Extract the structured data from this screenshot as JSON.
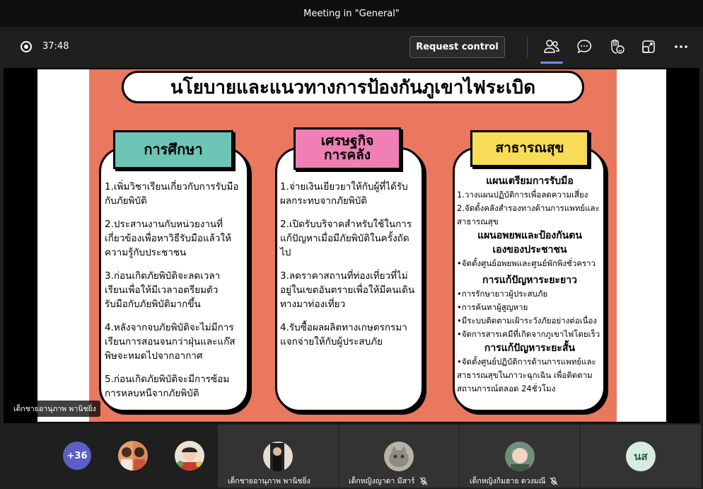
{
  "window": {
    "title": "Meeting in \"General\""
  },
  "toolbar": {
    "timer": "37:48",
    "request_control": "Request control",
    "icons": [
      "people-icon",
      "chat-icon",
      "reactions-icon",
      "share-tray-icon",
      "more-options-icon"
    ]
  },
  "slide": {
    "title": "นโยบายและแนวทางการป้องกันภูเขาไฟระเบิด",
    "col1": {
      "header": "การศึกษา",
      "header_color": "#6cc5b5",
      "items": [
        "1.เพิ่มวิชาเรียนเกี่ยวกับการรับมือกับภัยพิบัติ",
        "2.ประสานงานกับหน่วยงานที่เกี่ยวข้องเพื่อหาวิธีรับมือแล้วให้ความรู้กับประชาชน",
        "3.ก่อนเกิดภัยพิบัติจะลดเวลาเรียนเพื่อให้มีเวลาอตรียมตัวรับมือกับภัยพิบัติมากขึ้น",
        "4.หลังจากจบภัยพิบัติจะไม่มีการเรียนการสอนจนกว่าฝุ่นและแก๊สพิษจะหมดไปจากอากาศ",
        "5.ก่อนเกิดภัยพิบัติจะมีการซ้อมการหลบหนีจากภัยพิบัติ"
      ]
    },
    "col2": {
      "header_line1": "เศรษฐกิจ",
      "header_line2": "การคลัง",
      "header_color": "#ef7fb4",
      "items": [
        "1.จ่ายเงินเยียวยาให้กับผู้ที่ได้รับผลกระทบจากภัยพิบัติ",
        "2.เปิดรับบริจาคสำหรับใช้ในการแก้ปัญหาเมื่อมีภัยพิบัติในครั้งถัดไป",
        "3.ลดราคาสถานที่ท่องเที่ยวที่ไม่อยู่ในเขตอันตรายเพื่อให้มีคนเดินทางมาท่องเที่ยว",
        "4.รับซื้อผลผลิตทางเกษตรกรมาแจกจ่ายให้กับผู้ประสบภัย"
      ]
    },
    "col3": {
      "header": "สาธารณสุข",
      "header_color": "#f7dd57",
      "sec1_title": "แผนเตรียมการรับมือ",
      "sec1_items": [
        "1.วางแผนปฏิบัติการเพื่อลดความเสี่ยง",
        "2.จัดตั้งคลังสำรองทางด้านการแพทย์และ",
        "สาธารณสุข"
      ],
      "sec2_title_line1": "แผนอพยพและป้องกันตน",
      "sec2_title_line2": "เองของประชาชน",
      "sec2_items": [
        "•จัดตั้งศูนย์อพยพและศูนย์พักพิงชั่วคราว"
      ],
      "sec3_title": "การแก้ปัญหาระยะยาว",
      "sec3_items": [
        "•การรักษายาวผู้ประสบภัย",
        "•การค้นหาผู้สูญหาย",
        "•มีระบบติดตามเฝ้าระวังภัยอย่างต่อเนื่อง",
        "•จัดการสารเคมีที่เกิดจากภูเขาไฟโดยเร็ว"
      ],
      "sec4_title": "การแก้ปัญหาระยะสั้น",
      "sec4_items": [
        "•จัดตั้งศูนย์ปฏิบัติการด้านการแพทย์และ",
        "สาธารณสุขในภาวะฉุกเฉิน เพื่อติดตาม",
        "สถานการณ์ตลอด 24ชั่วโมง"
      ]
    }
  },
  "presenter": {
    "name": "เด็กชายอานุภาพ พานิชยิ่ง"
  },
  "gallery": {
    "more_count": "+36",
    "tiles": [
      {
        "name": "เด็กชายอานุภาพ พานิชยิ่ง"
      },
      {
        "name": "เด็กหญิงญาดา มีสาร์"
      },
      {
        "name": "เด็กหญิงกิมฮาย ดวงมณี"
      }
    ],
    "initials": "นส"
  },
  "colors": {
    "slide_bg": "#e9785e",
    "accent": "#5b5fc7"
  }
}
